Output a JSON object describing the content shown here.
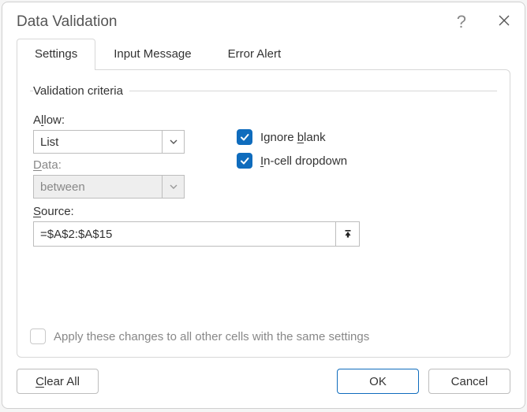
{
  "title": "Data Validation",
  "tabs": {
    "settings": "Settings",
    "input_message": "Input Message",
    "error_alert": "Error Alert"
  },
  "fieldset_legend": "Validation criteria",
  "labels": {
    "allow_pre": "A",
    "allow_u": "l",
    "allow_post": "low:",
    "data_pre": "",
    "data_u": "D",
    "data_post": "ata:",
    "source_pre": "",
    "source_u": "S",
    "source_post": "ource:"
  },
  "allow_value": "List",
  "data_value": "between",
  "source_value": "=$A$2:$A$15",
  "checks": {
    "ignore_blank_pre": "Ignore ",
    "ignore_blank_u": "b",
    "ignore_blank_post": "lank",
    "incell_pre": "",
    "incell_u": "I",
    "incell_post": "n-cell dropdown",
    "apply_label": "Apply these changes to all other cells with the same settings"
  },
  "buttons": {
    "clear_pre": "",
    "clear_u": "C",
    "clear_post": "lear All",
    "ok": "OK",
    "cancel": "Cancel"
  }
}
